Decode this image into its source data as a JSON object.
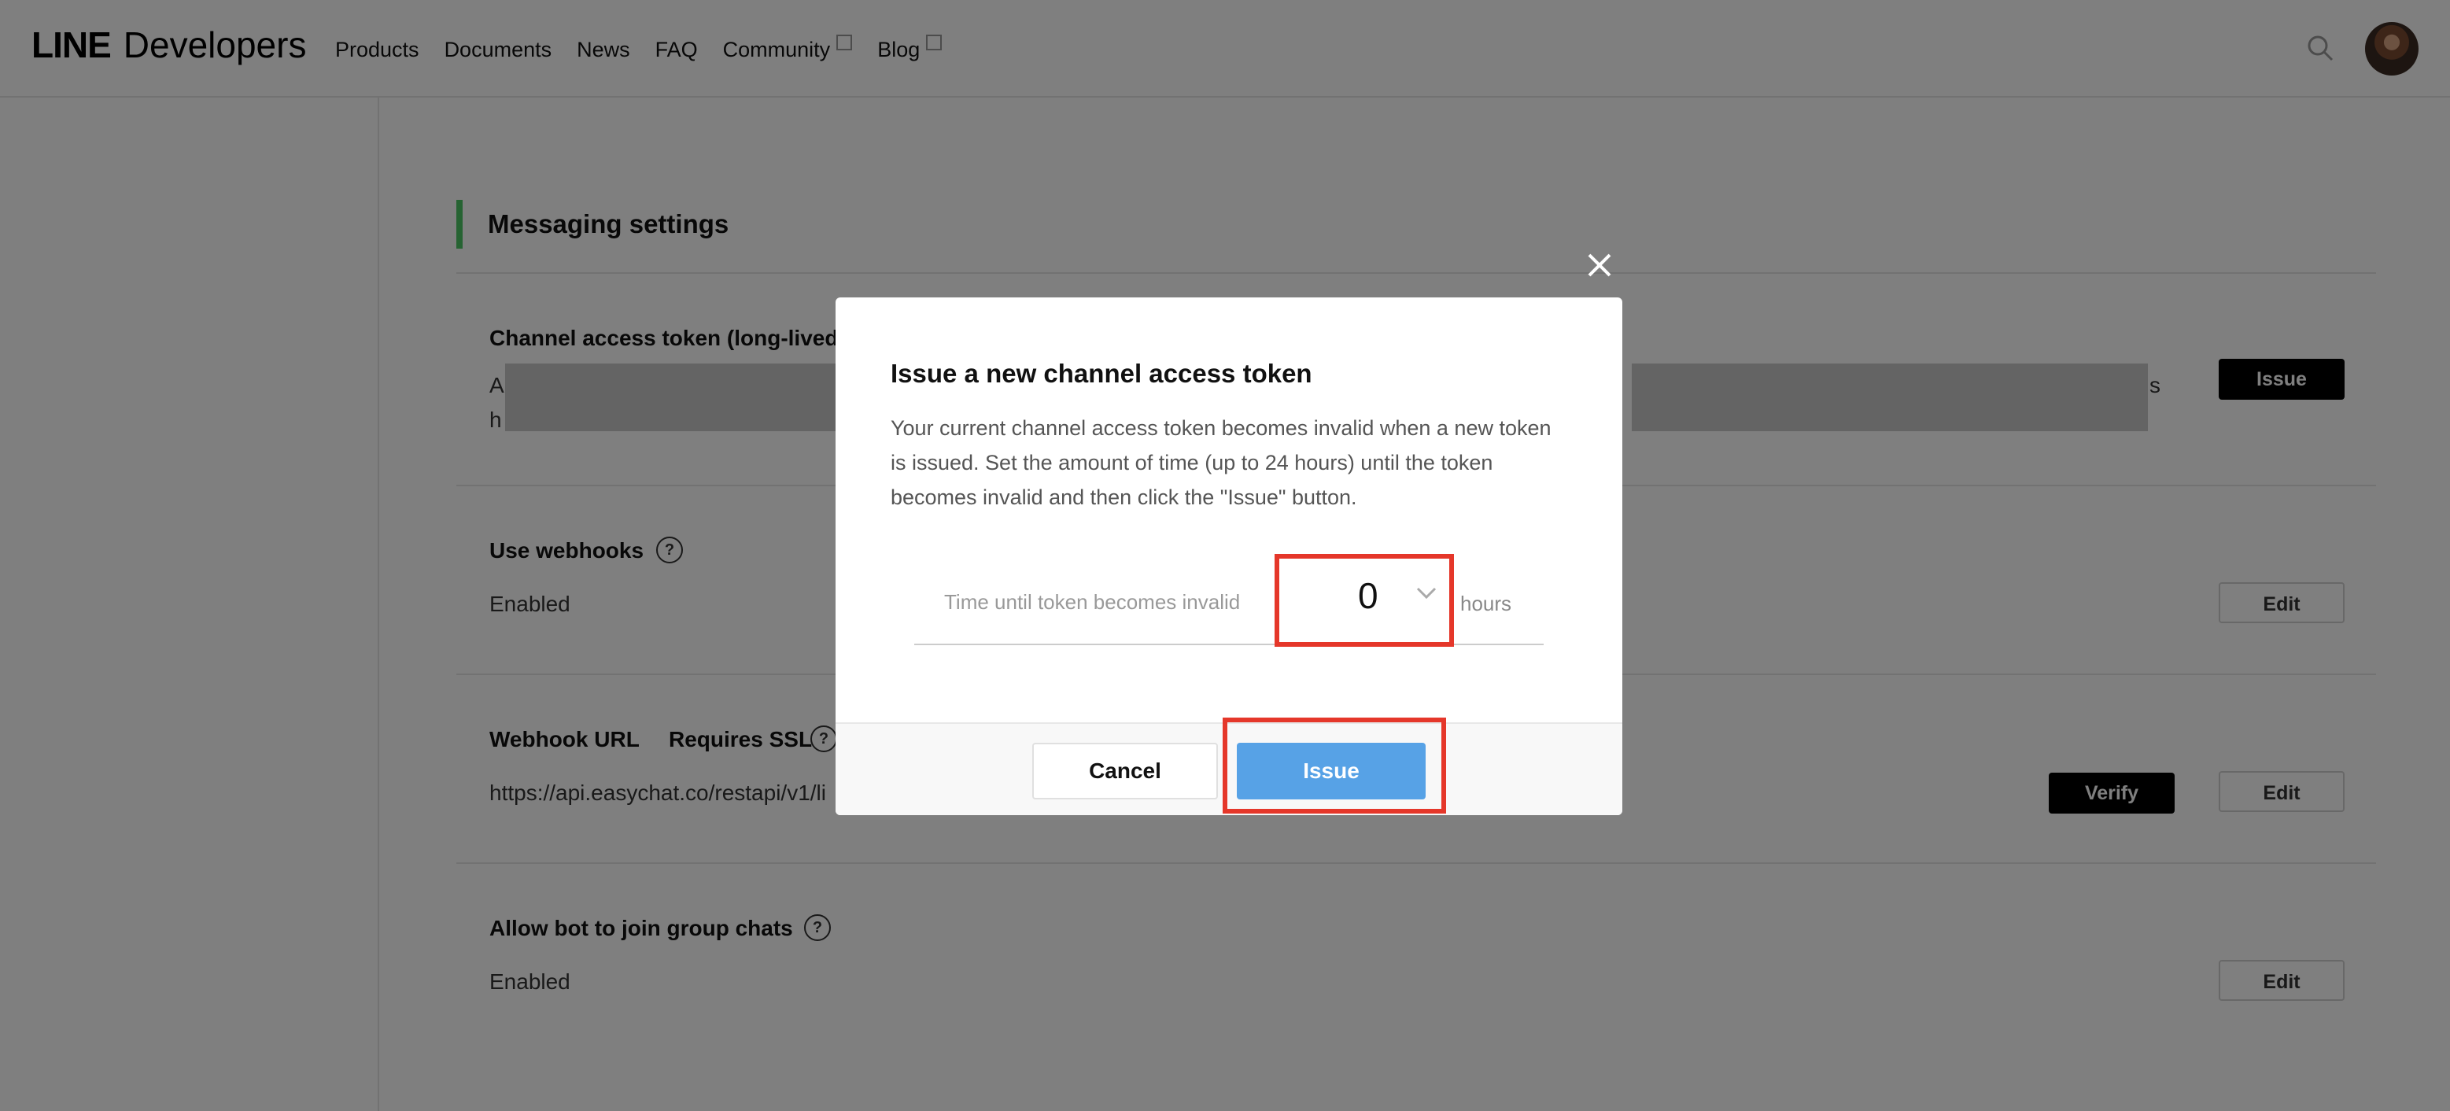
{
  "header": {
    "logo_line": "LINE",
    "logo_developers": "Developers",
    "nav": {
      "products": "Products",
      "documents": "Documents",
      "news": "News",
      "faq": "FAQ",
      "community": "Community",
      "blog": "Blog"
    }
  },
  "settings": {
    "section_title": "Messaging settings",
    "token_label": "Channel access token (long-lived",
    "token_start_1": "A",
    "token_start_2": "h",
    "token_end": "s",
    "issue_label": "Issue",
    "webhooks_label": "Use webhooks",
    "webhooks_value": "Enabled",
    "edit_label": "Edit",
    "webhook_url_label": "Webhook URL",
    "requires_ssl": "Requires SSL",
    "webhook_url_value": "https://api.easychat.co/restapi/v1/li",
    "verify_label": "Verify",
    "group_chat_label": "Allow bot to join group chats",
    "group_chat_value": "Enabled",
    "help_glyph": "?"
  },
  "modal": {
    "title": "Issue a new channel access token",
    "description": "Your current channel access token becomes invalid when a new token is issued. Set the amount of time (up to 24 hours) until the token becomes invalid and then click the \"Issue\" button.",
    "field_label": "Time until token becomes invalid",
    "selected_hours": "0",
    "hours_unit": "hours",
    "cancel_label": "Cancel",
    "issue_label": "Issue"
  },
  "colors": {
    "accent_green": "#4cc764",
    "issue_blue": "#57a2e6",
    "highlight_red": "#e5372a",
    "overlay": "rgba(0,0,0,0.5)"
  },
  "icons": [
    "search-icon",
    "external-link-icon",
    "help-icon",
    "close-icon",
    "chevron-down-icon"
  ]
}
